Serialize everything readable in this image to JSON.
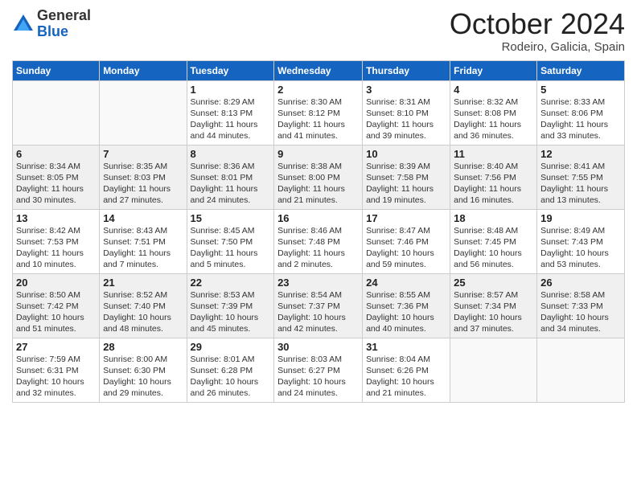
{
  "header": {
    "logo_general": "General",
    "logo_blue": "Blue",
    "month_title": "October 2024",
    "location": "Rodeiro, Galicia, Spain"
  },
  "days_of_week": [
    "Sunday",
    "Monday",
    "Tuesday",
    "Wednesday",
    "Thursday",
    "Friday",
    "Saturday"
  ],
  "weeks": [
    [
      {
        "day": "",
        "info": ""
      },
      {
        "day": "",
        "info": ""
      },
      {
        "day": "1",
        "info": "Sunrise: 8:29 AM\nSunset: 8:13 PM\nDaylight: 11 hours and 44 minutes."
      },
      {
        "day": "2",
        "info": "Sunrise: 8:30 AM\nSunset: 8:12 PM\nDaylight: 11 hours and 41 minutes."
      },
      {
        "day": "3",
        "info": "Sunrise: 8:31 AM\nSunset: 8:10 PM\nDaylight: 11 hours and 39 minutes."
      },
      {
        "day": "4",
        "info": "Sunrise: 8:32 AM\nSunset: 8:08 PM\nDaylight: 11 hours and 36 minutes."
      },
      {
        "day": "5",
        "info": "Sunrise: 8:33 AM\nSunset: 8:06 PM\nDaylight: 11 hours and 33 minutes."
      }
    ],
    [
      {
        "day": "6",
        "info": "Sunrise: 8:34 AM\nSunset: 8:05 PM\nDaylight: 11 hours and 30 minutes."
      },
      {
        "day": "7",
        "info": "Sunrise: 8:35 AM\nSunset: 8:03 PM\nDaylight: 11 hours and 27 minutes."
      },
      {
        "day": "8",
        "info": "Sunrise: 8:36 AM\nSunset: 8:01 PM\nDaylight: 11 hours and 24 minutes."
      },
      {
        "day": "9",
        "info": "Sunrise: 8:38 AM\nSunset: 8:00 PM\nDaylight: 11 hours and 21 minutes."
      },
      {
        "day": "10",
        "info": "Sunrise: 8:39 AM\nSunset: 7:58 PM\nDaylight: 11 hours and 19 minutes."
      },
      {
        "day": "11",
        "info": "Sunrise: 8:40 AM\nSunset: 7:56 PM\nDaylight: 11 hours and 16 minutes."
      },
      {
        "day": "12",
        "info": "Sunrise: 8:41 AM\nSunset: 7:55 PM\nDaylight: 11 hours and 13 minutes."
      }
    ],
    [
      {
        "day": "13",
        "info": "Sunrise: 8:42 AM\nSunset: 7:53 PM\nDaylight: 11 hours and 10 minutes."
      },
      {
        "day": "14",
        "info": "Sunrise: 8:43 AM\nSunset: 7:51 PM\nDaylight: 11 hours and 7 minutes."
      },
      {
        "day": "15",
        "info": "Sunrise: 8:45 AM\nSunset: 7:50 PM\nDaylight: 11 hours and 5 minutes."
      },
      {
        "day": "16",
        "info": "Sunrise: 8:46 AM\nSunset: 7:48 PM\nDaylight: 11 hours and 2 minutes."
      },
      {
        "day": "17",
        "info": "Sunrise: 8:47 AM\nSunset: 7:46 PM\nDaylight: 10 hours and 59 minutes."
      },
      {
        "day": "18",
        "info": "Sunrise: 8:48 AM\nSunset: 7:45 PM\nDaylight: 10 hours and 56 minutes."
      },
      {
        "day": "19",
        "info": "Sunrise: 8:49 AM\nSunset: 7:43 PM\nDaylight: 10 hours and 53 minutes."
      }
    ],
    [
      {
        "day": "20",
        "info": "Sunrise: 8:50 AM\nSunset: 7:42 PM\nDaylight: 10 hours and 51 minutes."
      },
      {
        "day": "21",
        "info": "Sunrise: 8:52 AM\nSunset: 7:40 PM\nDaylight: 10 hours and 48 minutes."
      },
      {
        "day": "22",
        "info": "Sunrise: 8:53 AM\nSunset: 7:39 PM\nDaylight: 10 hours and 45 minutes."
      },
      {
        "day": "23",
        "info": "Sunrise: 8:54 AM\nSunset: 7:37 PM\nDaylight: 10 hours and 42 minutes."
      },
      {
        "day": "24",
        "info": "Sunrise: 8:55 AM\nSunset: 7:36 PM\nDaylight: 10 hours and 40 minutes."
      },
      {
        "day": "25",
        "info": "Sunrise: 8:57 AM\nSunset: 7:34 PM\nDaylight: 10 hours and 37 minutes."
      },
      {
        "day": "26",
        "info": "Sunrise: 8:58 AM\nSunset: 7:33 PM\nDaylight: 10 hours and 34 minutes."
      }
    ],
    [
      {
        "day": "27",
        "info": "Sunrise: 7:59 AM\nSunset: 6:31 PM\nDaylight: 10 hours and 32 minutes."
      },
      {
        "day": "28",
        "info": "Sunrise: 8:00 AM\nSunset: 6:30 PM\nDaylight: 10 hours and 29 minutes."
      },
      {
        "day": "29",
        "info": "Sunrise: 8:01 AM\nSunset: 6:28 PM\nDaylight: 10 hours and 26 minutes."
      },
      {
        "day": "30",
        "info": "Sunrise: 8:03 AM\nSunset: 6:27 PM\nDaylight: 10 hours and 24 minutes."
      },
      {
        "day": "31",
        "info": "Sunrise: 8:04 AM\nSunset: 6:26 PM\nDaylight: 10 hours and 21 minutes."
      },
      {
        "day": "",
        "info": ""
      },
      {
        "day": "",
        "info": ""
      }
    ]
  ]
}
